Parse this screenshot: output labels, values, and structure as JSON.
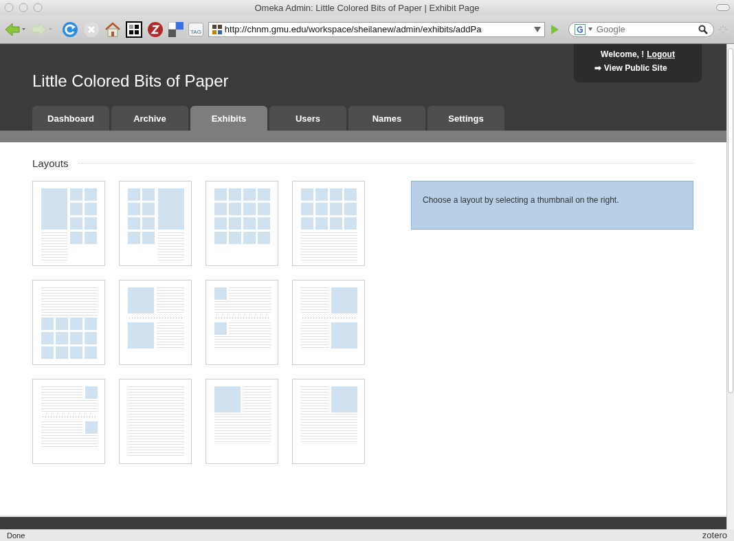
{
  "window": {
    "title": "Omeka Admin: Little Colored Bits of Paper | Exhibit Page"
  },
  "toolbar": {
    "tag_label": "TAG",
    "url": "http://chnm.gmu.edu/workspace/sheilanew/admin/exhibits/addPa",
    "search": {
      "placeholder": "Google"
    }
  },
  "header": {
    "site_title": "Little Colored Bits of Paper",
    "welcome": "Welcome, !",
    "logout": "Logout",
    "arrow": "➡",
    "view_public_site": "View Public Site"
  },
  "tabs": [
    {
      "label": "Dashboard",
      "selected": false
    },
    {
      "label": "Archive",
      "selected": false
    },
    {
      "label": "Exhibits",
      "selected": true
    },
    {
      "label": "Users",
      "selected": false
    },
    {
      "label": "Names",
      "selected": false
    },
    {
      "label": "Settings",
      "selected": false
    }
  ],
  "layouts_section": {
    "heading": "Layouts",
    "layouts": [
      {
        "kind": "gallery-full-left"
      },
      {
        "kind": "gallery-full-right"
      },
      {
        "kind": "gallery-thumbnails"
      },
      {
        "kind": "gallery-thumbnails-text-bottom"
      },
      {
        "kind": "text-gallery-bottom"
      },
      {
        "kind": "image-list-left"
      },
      {
        "kind": "image-list-left-thumbs"
      },
      {
        "kind": "image-list-right"
      },
      {
        "kind": "image-list-right-thumbs"
      },
      {
        "kind": "text"
      },
      {
        "kind": "text-image-left"
      },
      {
        "kind": "text-image-right"
      }
    ]
  },
  "info": "Choose a layout by selecting a thumbnail on the right.",
  "status_bar": {
    "text": "Done",
    "extension": "zotero"
  }
}
